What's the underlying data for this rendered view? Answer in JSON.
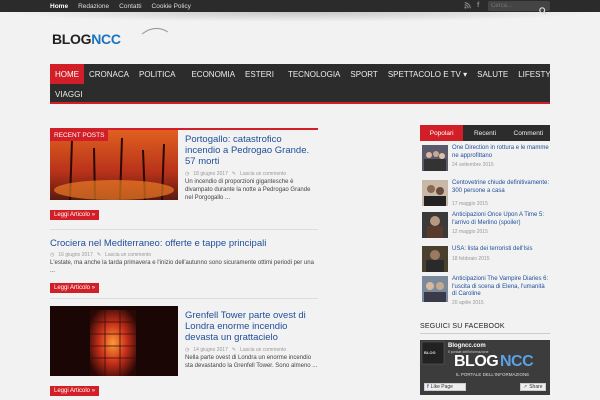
{
  "topnav": [
    "Home",
    "Redazione",
    "Contatti",
    "Cookie Policy"
  ],
  "search_placeholder": "Cerca...",
  "logo": {
    "part1": "BLOG",
    "part2": "NCC"
  },
  "mainnav": {
    "row1": [
      "HOME",
      "CRONACA",
      "POLITICA",
      "ECONOMIA",
      "ESTERI",
      "TECNOLOGIA",
      "SPORT",
      "SPETTACOLO E TV ▾",
      "SALUTE",
      "LIFESTYLE"
    ],
    "row2": [
      "VIAGGI"
    ]
  },
  "recent_label": "RECENT POSTS",
  "read_more": "Leggi Articolo »",
  "posts": [
    {
      "title": "Portogallo: catastrofico incendio a Pedrogao Grande. 57 morti",
      "date": "18 giugno 2017",
      "comments": "Lascia un commento",
      "excerpt": "Un incendio di proporzioni gigantesche è divampato durante la notte a Pedrogao Grande nel Porgogallo ..."
    },
    {
      "title": "Crociera nel Mediterraneo: offerte e tappe principali",
      "date": "16 giugno 2017",
      "comments": "Lascia un commento",
      "excerpt": "L'estate, ma anche la tarda primavera e l'inizio dell'autunno sono sicuramente ottimi periodi per una ..."
    },
    {
      "title": "Grenfell Tower parte ovest di Londra enorme incendio devasta un grattacielo",
      "date": "14 giugno 2017",
      "comments": "Lascia un commento",
      "excerpt": "Nella parte ovest di Londra un enorme incendio sta devastando la Grenfell Tower. Sono almeno ..."
    }
  ],
  "tabs": [
    "Popolari",
    "Recenti",
    "Commenti"
  ],
  "sidebar_items": [
    {
      "title": "One Direction in rottura e le mamme ne approfittano",
      "date": "24 settembre 2015"
    },
    {
      "title": "Centovetrine chiude definitivamente: 300 persone a casa",
      "date": "17 maggio 2015"
    },
    {
      "title": "Anticipazioni Once Upon A Time 5: l'arrivo di Merlino (spoiler)",
      "date": "12 maggio 2015"
    },
    {
      "title": "USA: lista dei terroristi dell'Isis",
      "date": "18 febbraio 2015"
    },
    {
      "title": "Anticipazioni The Vampire Diaries 6: l'uscita di scena di Elena, l'umanità di Caroline",
      "date": "20 aprile 2015"
    }
  ],
  "facebook": {
    "heading": "SEGUICI SU FACEBOOK",
    "page_name": "Blogncc.com",
    "subtitle": "Il portale dell'informazione",
    "logo_a": "BLOG",
    "logo_b": "NCC",
    "tagline": "IL PORTALE DELL'INFORMAZIONE",
    "like": "Like Page",
    "share": "Share"
  },
  "colors": {
    "accent": "#d21e26",
    "link": "#1e4e9a",
    "nav": "#2c2c2c"
  }
}
